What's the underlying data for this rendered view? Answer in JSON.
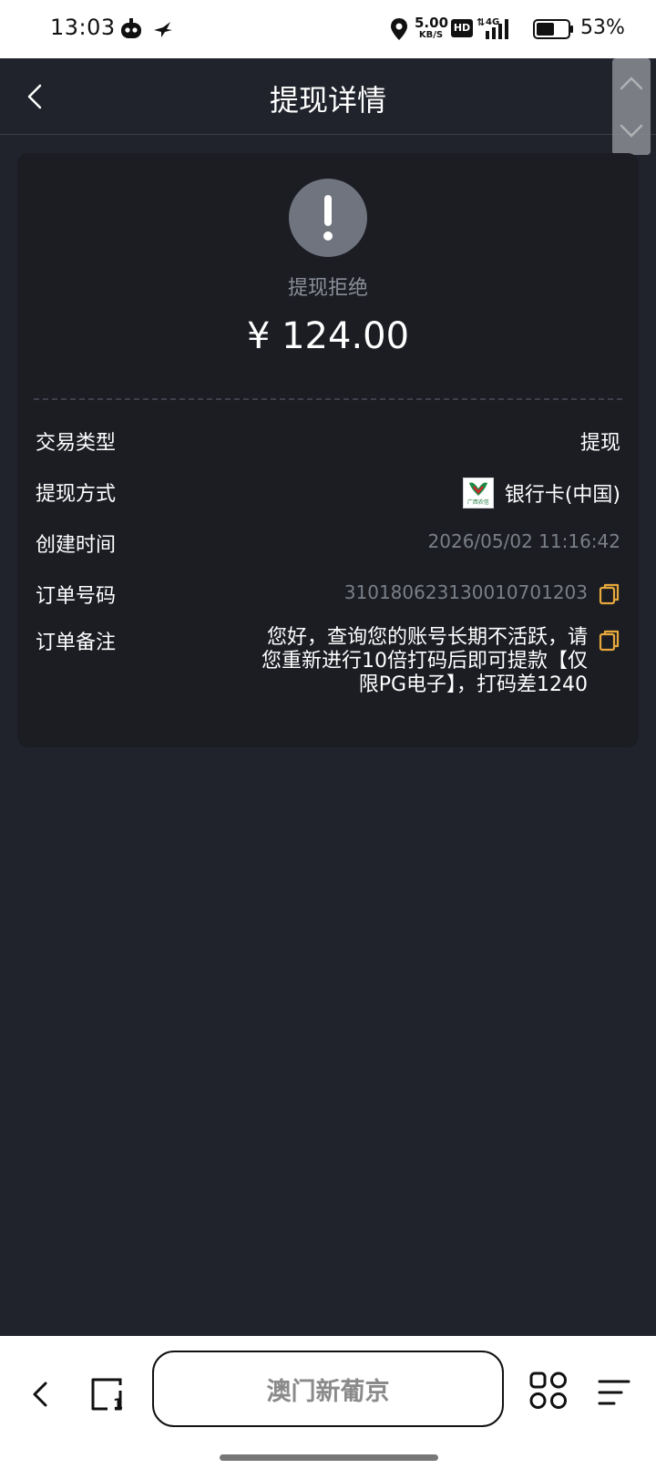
{
  "status_bar": {
    "time": "13:03",
    "net_speed_value": "5.00",
    "net_speed_unit": "KB/S",
    "hd_label": "HD",
    "network_type": "4G",
    "battery_percent": "53%"
  },
  "header": {
    "title": "提现详情"
  },
  "status": {
    "icon": "exclamation-icon",
    "text": "提现拒绝",
    "amount": "¥ 124.00"
  },
  "details": {
    "type": {
      "label": "交易类型",
      "value": "提现"
    },
    "method": {
      "label": "提现方式",
      "value": "银行卡(中国)",
      "bank_logo_text": "广西农信"
    },
    "created": {
      "label": "创建时间",
      "value": "2026/05/02 11:16:42"
    },
    "order": {
      "label": "订单号码",
      "value": "3101806231300107012​03"
    },
    "remark": {
      "label": "订单备注",
      "value": "您好，查询您的账号长期不活跃，请您重新进行10倍打码后即可提款【仅限PG电子】，打码差1240"
    }
  },
  "bottom_bar": {
    "title": "澳门新葡京"
  },
  "colors": {
    "background": "#20232b",
    "card": "#1b1d23",
    "muted_text": "#7b7f88",
    "copy_icon": "#e8a93c"
  }
}
